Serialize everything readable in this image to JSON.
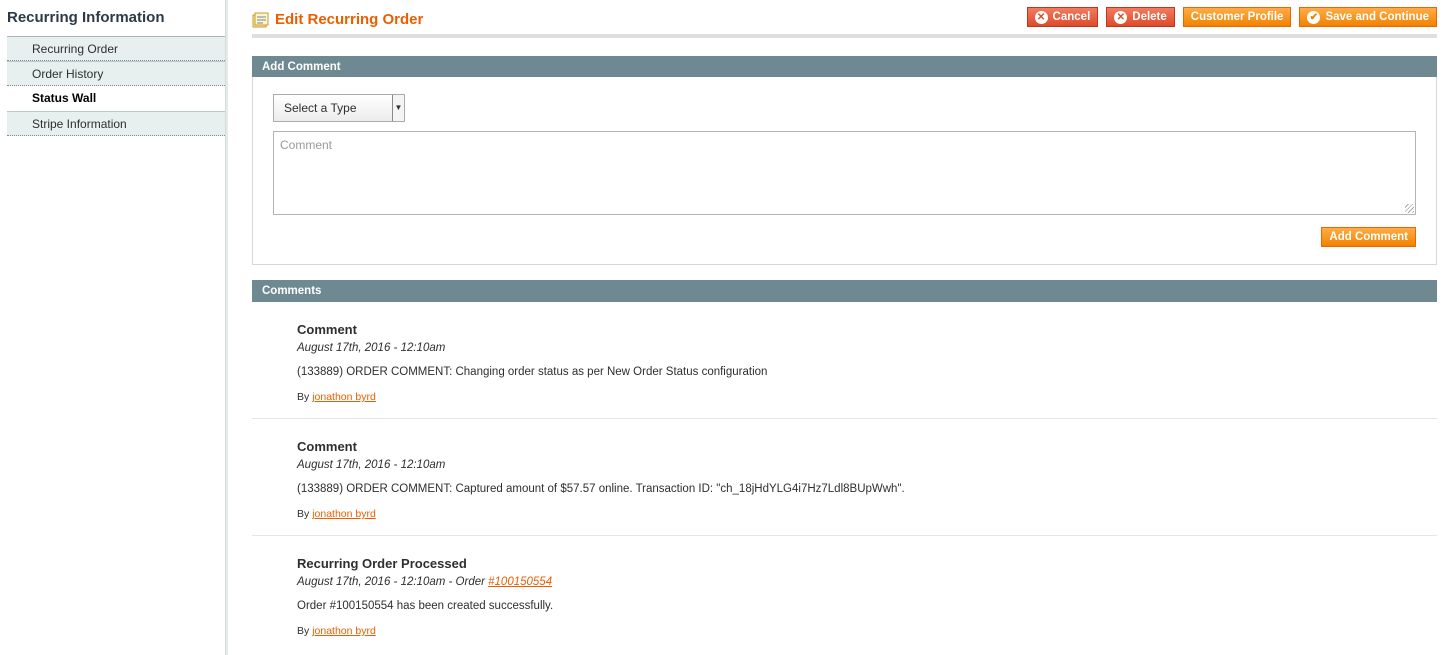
{
  "sidebar": {
    "title": "Recurring Information",
    "items": [
      {
        "label": "Recurring Order"
      },
      {
        "label": "Order History"
      },
      {
        "label": "Status Wall"
      },
      {
        "label": "Stripe Information"
      }
    ],
    "active_item": "Status Wall"
  },
  "header": {
    "title": "Edit Recurring Order",
    "actions": {
      "cancel": "Cancel",
      "delete": "Delete",
      "customer_profile": "Customer Profile",
      "save_continue": "Save and Continue"
    }
  },
  "add_comment": {
    "section_title": "Add Comment",
    "type_select": {
      "selected": "Select a Type"
    },
    "comment_placeholder": "Comment",
    "submit_label": "Add Comment"
  },
  "comments": {
    "section_title": "Comments",
    "by_label": "By",
    "items": [
      {
        "title": "Comment",
        "date": "August 17th, 2016 - 12:10am",
        "text": "(133889) ORDER COMMENT: Changing order status as per New Order Status configuration",
        "author": "jonathon byrd"
      },
      {
        "title": "Comment",
        "date": "August 17th, 2016 - 12:10am",
        "text": "(133889) ORDER COMMENT: Captured amount of $57.57 online. Transaction ID: \"ch_18jHdYLG4i7Hz7Ldl8BUpWwh\".",
        "author": "jonathon byrd"
      },
      {
        "title": "Recurring Order Processed",
        "date": "August 17th, 2016 - 12:10am - Order ",
        "order_link": "#100150554",
        "text": "Order #100150554 has been created successfully.",
        "author": "jonathon byrd"
      }
    ]
  },
  "colors": {
    "accent": "#eb5e00",
    "section_head": "#6f8992",
    "button": "#f18200",
    "button_red": "#de4b2c"
  },
  "icons": {
    "title": "edit-order-icon",
    "cancel": "cancel-icon",
    "delete": "delete-icon",
    "save": "checkmark-icon",
    "select": "dropdown-arrow-icon"
  }
}
